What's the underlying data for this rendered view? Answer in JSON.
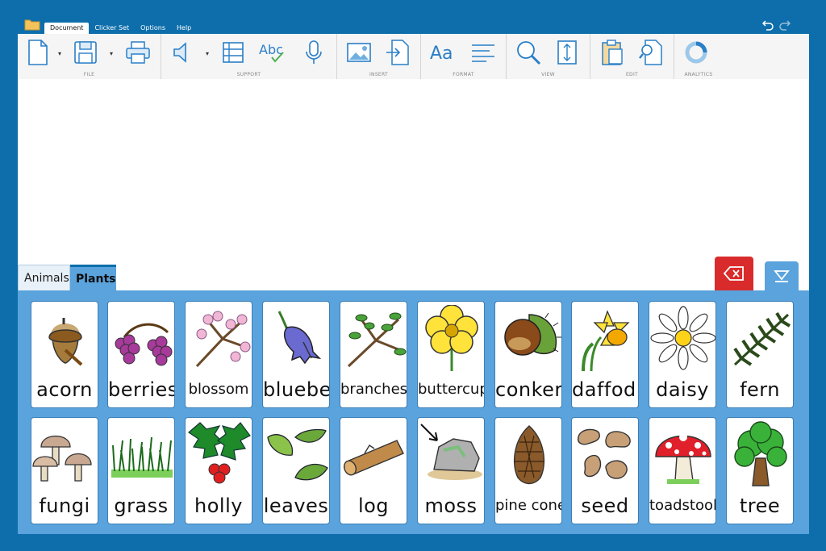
{
  "menu": {
    "items": [
      "Document",
      "Clicker Set",
      "Options",
      "Help"
    ],
    "active": 0
  },
  "ribbon": {
    "groups": [
      "FILE",
      "SUPPORT",
      "INSERT",
      "FORMAT",
      "VIEW",
      "EDIT",
      "ANALYTICS"
    ]
  },
  "tabs": {
    "animals": "Animals",
    "plants": "Plants"
  },
  "grid": {
    "row1": [
      "acorn",
      "berries",
      "blossom",
      "bluebell",
      "branches",
      "buttercup",
      "conker",
      "daffodil",
      "daisy",
      "fern"
    ],
    "row2": [
      "fungi",
      "grass",
      "holly",
      "leaves",
      "log",
      "moss",
      "pine cone",
      "seed",
      "toadstool",
      "tree"
    ]
  },
  "colors": {
    "background": "#0d6eab",
    "panel": "#5aa3dc",
    "delete": "#d92b2b",
    "ribbon": "#f5f5f5"
  }
}
